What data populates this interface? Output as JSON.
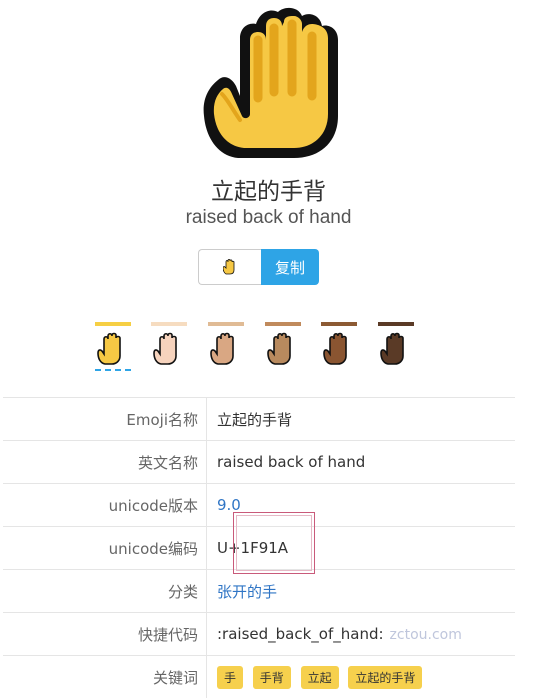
{
  "emoji": {
    "char": "🫲",
    "name_cn": "立起的手背",
    "name_en": "raised back of hand"
  },
  "copy": {
    "button_label": "复制"
  },
  "skin_tones": [
    {
      "name": "default",
      "color": "#f6cf44",
      "selected": true
    },
    {
      "name": "light",
      "color": "#f6dcc0",
      "selected": false
    },
    {
      "name": "medium-light",
      "color": "#e0bb95",
      "selected": false
    },
    {
      "name": "medium",
      "color": "#c08a5c",
      "selected": false
    },
    {
      "name": "medium-dark",
      "color": "#8c5a33",
      "selected": false
    },
    {
      "name": "dark",
      "color": "#5a3a26",
      "selected": false
    }
  ],
  "details": {
    "rows": [
      {
        "key": "Emoji名称",
        "value": "立起的手背"
      },
      {
        "key": "英文名称",
        "value": "raised back of hand"
      },
      {
        "key": "unicode版本",
        "value": "9.0"
      },
      {
        "key": "unicode编码",
        "value": "U+1F91A"
      },
      {
        "key": "分类",
        "value": "张开的手"
      },
      {
        "key": "快捷代码",
        "value": ":raised_back_of_hand:"
      },
      {
        "key": "关键词",
        "value": ""
      }
    ],
    "watermark": "zctou.com",
    "keywords": [
      "手",
      "手背",
      "立起",
      "立起的手背"
    ]
  },
  "colors": {
    "accent": "#2ea4e6",
    "link": "#2f75c5",
    "keyword_bg": "#f6d04d"
  }
}
